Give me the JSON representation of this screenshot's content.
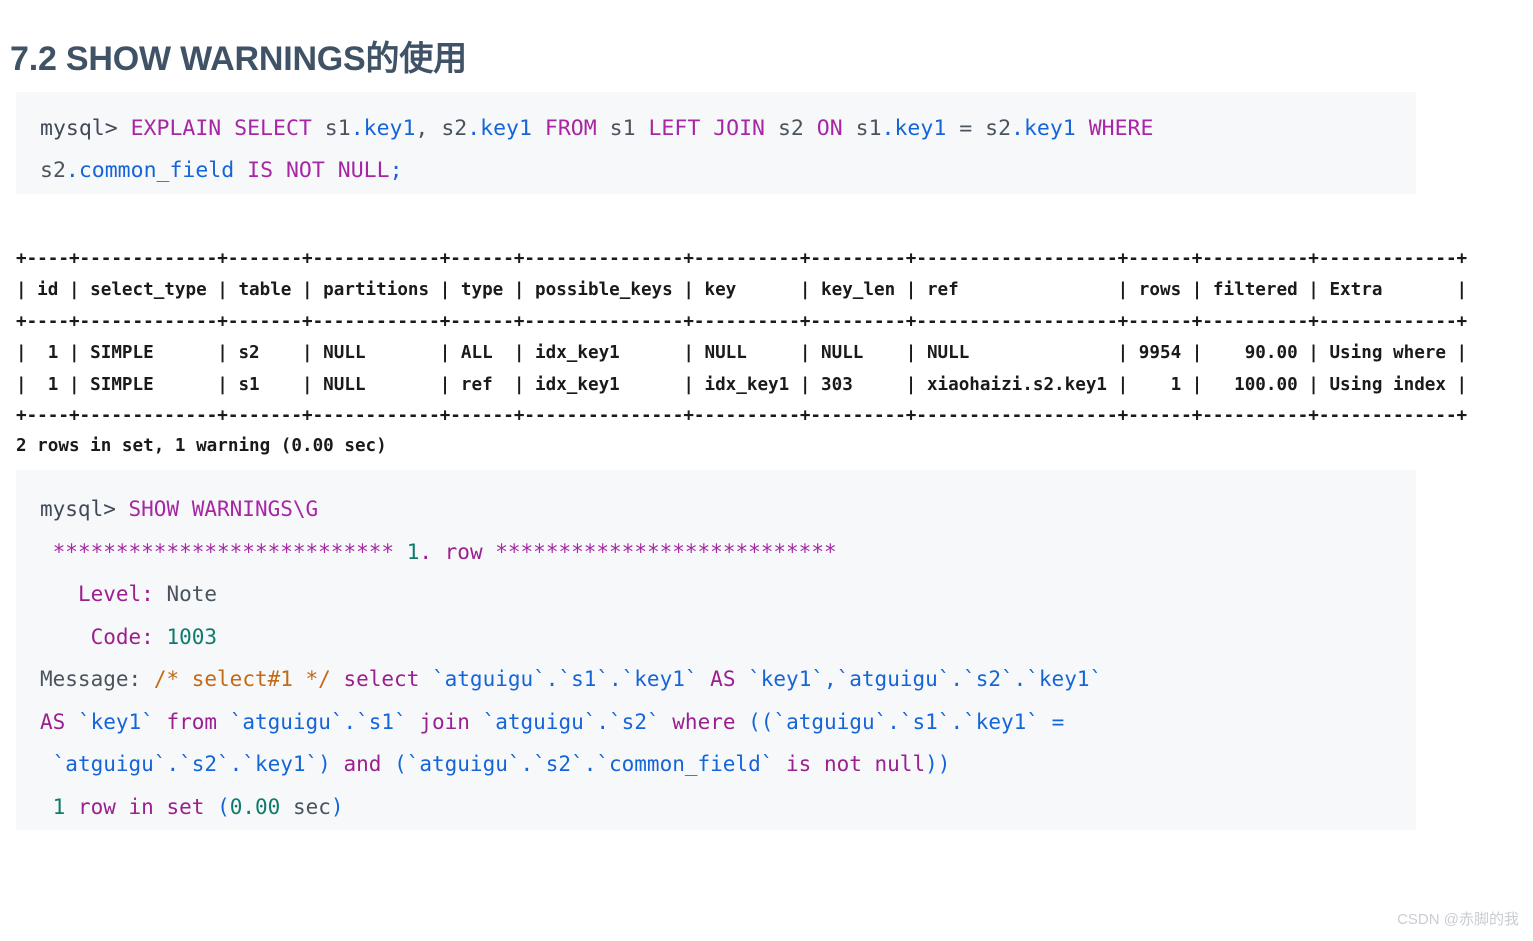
{
  "page": {
    "title": "7.2 SHOW WARNINGS的使用",
    "title_color": "#3f5266",
    "background": "#ffffff",
    "code_background": "#f7f8fa"
  },
  "colors": {
    "keyword": "#a626a4",
    "identifier": "#4a545e",
    "column": "#1565d8",
    "number": "#0f7b6c",
    "comment": "#c26a15",
    "table_text": "#1a1a1a",
    "watermark": "#c9cdd2"
  },
  "sql_block_1": {
    "prompt": "mysql> ",
    "line1_tokens": [
      {
        "t": "EXPLAIN",
        "c": "kw"
      },
      {
        "t": " ",
        "c": "plain"
      },
      {
        "t": "SELECT",
        "c": "kw"
      },
      {
        "t": " ",
        "c": "plain"
      },
      {
        "t": "s1",
        "c": "ident"
      },
      {
        "t": ".",
        "c": "punct"
      },
      {
        "t": "key1",
        "c": "col"
      },
      {
        "t": ", ",
        "c": "plain"
      },
      {
        "t": "s2",
        "c": "ident"
      },
      {
        "t": ".",
        "c": "punct"
      },
      {
        "t": "key1",
        "c": "col"
      },
      {
        "t": " ",
        "c": "plain"
      },
      {
        "t": "FROM",
        "c": "kw"
      },
      {
        "t": " ",
        "c": "plain"
      },
      {
        "t": "s1",
        "c": "ident"
      },
      {
        "t": " ",
        "c": "plain"
      },
      {
        "t": "LEFT",
        "c": "kw"
      },
      {
        "t": " ",
        "c": "plain"
      },
      {
        "t": "JOIN",
        "c": "kw"
      },
      {
        "t": " ",
        "c": "plain"
      },
      {
        "t": "s2",
        "c": "ident"
      },
      {
        "t": " ",
        "c": "plain"
      },
      {
        "t": "ON",
        "c": "kw"
      },
      {
        "t": " ",
        "c": "plain"
      },
      {
        "t": "s1",
        "c": "ident"
      },
      {
        "t": ".",
        "c": "punct"
      },
      {
        "t": "key1",
        "c": "col"
      },
      {
        "t": " = ",
        "c": "plain"
      },
      {
        "t": "s2",
        "c": "ident"
      },
      {
        "t": ".",
        "c": "punct"
      },
      {
        "t": "key1",
        "c": "col"
      },
      {
        "t": " ",
        "c": "plain"
      },
      {
        "t": "WHERE",
        "c": "kw"
      }
    ],
    "line2_tokens": [
      {
        "t": "s2",
        "c": "ident"
      },
      {
        "t": ".",
        "c": "punct"
      },
      {
        "t": "common_field",
        "c": "col"
      },
      {
        "t": " ",
        "c": "plain"
      },
      {
        "t": "IS",
        "c": "kw"
      },
      {
        "t": " ",
        "c": "plain"
      },
      {
        "t": "NOT",
        "c": "kw"
      },
      {
        "t": " ",
        "c": "plain"
      },
      {
        "t": "NULL",
        "c": "kw"
      },
      {
        "t": ";",
        "c": "punct"
      }
    ],
    "full_text": "mysql> EXPLAIN SELECT s1.key1, s2.key1 FROM s1 LEFT JOIN s2 ON s1.key1 = s2.key1 WHERE s2.common_field IS NOT NULL;"
  },
  "explain_result": {
    "columns": [
      "id",
      "select_type",
      "table",
      "partitions",
      "type",
      "possible_keys",
      "key",
      "key_len",
      "ref",
      "rows",
      "filtered",
      "Extra"
    ],
    "rows": [
      {
        "id": "1",
        "select_type": "SIMPLE",
        "table": "s2",
        "partitions": "NULL",
        "type": "ALL",
        "possible_keys": "idx_key1",
        "key": "NULL",
        "key_len": "NULL",
        "ref": "NULL",
        "rows": "9954",
        "filtered": "90.00",
        "Extra": "Using where"
      },
      {
        "id": "1",
        "select_type": "SIMPLE",
        "table": "s1",
        "partitions": "NULL",
        "type": "ref",
        "possible_keys": "idx_key1",
        "key": "idx_key1",
        "key_len": "303",
        "ref": "xiaohaizi.s2.key1",
        "rows": "1",
        "filtered": "100.00",
        "Extra": "Using index"
      }
    ],
    "ascii": "+----+-------------+-------+------------+------+---------------+----------+---------+-------------------+------+----------+-------------+\n| id | select_type | table | partitions | type | possible_keys | key      | key_len | ref               | rows | filtered | Extra       |\n+----+-------------+-------+------------+------+---------------+----------+---------+-------------------+------+----------+-------------+\n|  1 | SIMPLE      | s2    | NULL       | ALL  | idx_key1      | NULL     | NULL    | NULL              | 9954 |    90.00 | Using where |\n|  1 | SIMPLE      | s1    | NULL       | ref  | idx_key1      | idx_key1 | 303     | xiaohaizi.s2.key1 |    1 |   100.00 | Using index |\n+----+-------------+-------+------------+------+---------------+----------+---------+-------------------+------+----------+-------------+",
    "status": "2 rows in set, 1 warning (0.00 sec)"
  },
  "sql_block_2": {
    "prompt": "mysql> ",
    "command": "SHOW WARNINGS\\G",
    "row_separator_left": "***************************",
    "row_number": "1",
    "row_dot": ".",
    "row_word": "row",
    "row_separator_right": "***************************",
    "level_label": "Level:",
    "level_value": "Note",
    "code_label": "Code:",
    "code_value": "1003",
    "message_label": "Message:",
    "message_comment": "/* select#1 */",
    "message_text": "/* select#1 */ select `atguigu`.`s1`.`key1` AS `key1`,`atguigu`.`s2`.`key1` AS `key1` from `atguigu`.`s1` join `atguigu`.`s2` where ((`atguigu`.`s1`.`key1` = `atguigu`.`s2`.`key1`) and (`atguigu`.`s2`.`common_field` is not null))",
    "status_count": "1",
    "status_words": "row in set",
    "status_time": "0.00",
    "status_unit": "sec",
    "status": "1 row in set (0.00 sec)"
  },
  "watermark": {
    "text": "CSDN @赤脚的我"
  }
}
